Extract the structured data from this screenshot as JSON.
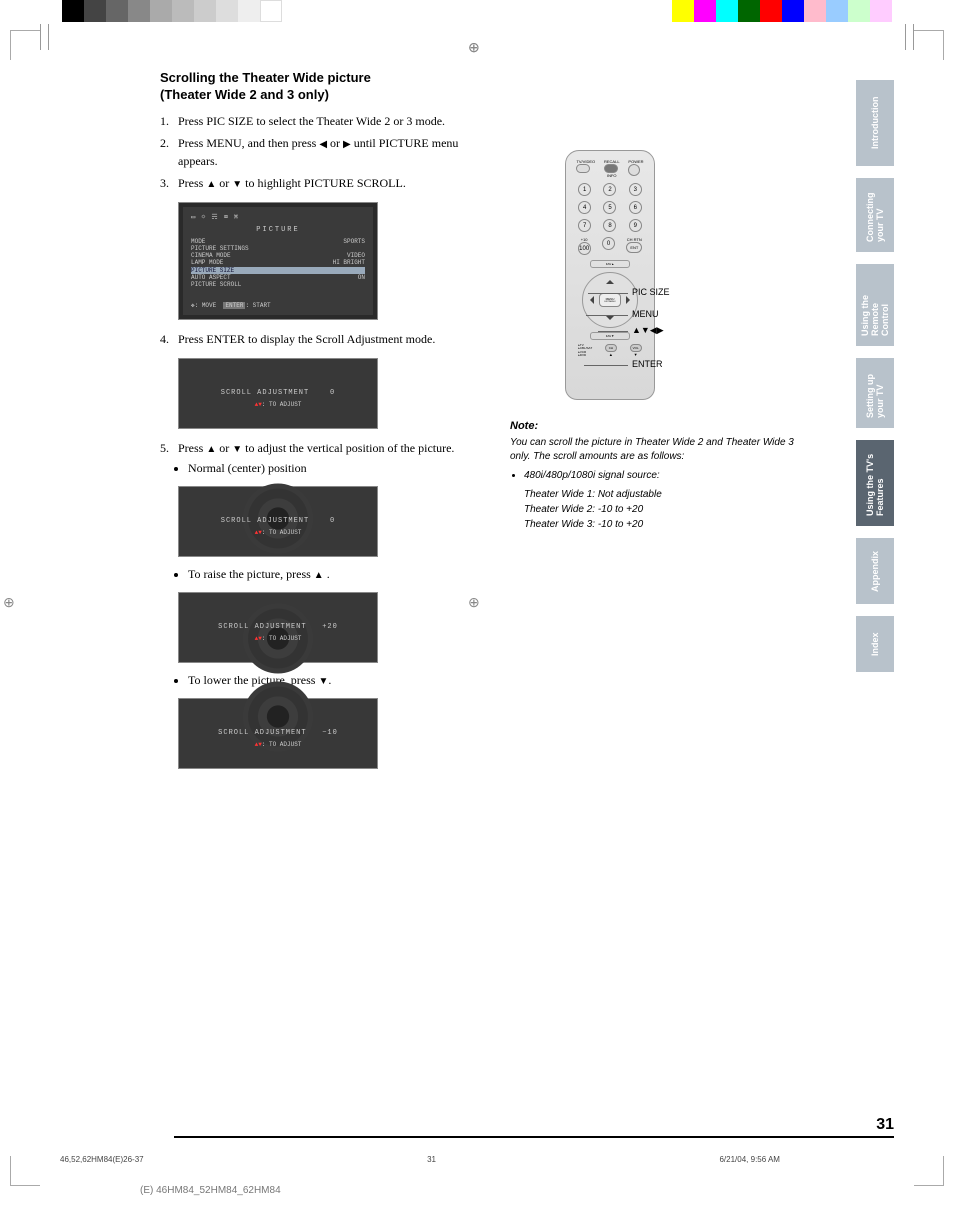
{
  "header": {
    "title_line1": "Scrolling the Theater Wide picture",
    "title_line2": "(Theater Wide 2 and 3 only)"
  },
  "steps": {
    "s1": "Press PIC SIZE to select the Theater Wide 2 or 3 mode.",
    "s2a": "Press MENU, and then press ",
    "s2b": " or ",
    "s2c": " until PICTURE menu appears.",
    "s3a": "Press ",
    "s3b": " or ",
    "s3c": " to highlight PICTURE SCROLL.",
    "s4": "Press ENTER to display the Scroll Adjustment mode.",
    "s5a": "Press ",
    "s5b": " or ",
    "s5c": " to adjust the vertical position of the picture.",
    "bullet_normal": "Normal (center) position",
    "bullet_raise_a": "To raise the picture, press ",
    "bullet_raise_b": " .",
    "bullet_lower_a": "To lower the picture, press ",
    "bullet_lower_b": "."
  },
  "osd_menu": {
    "title": "PICTURE",
    "rows": [
      {
        "l": "MODE",
        "r": "SPORTS"
      },
      {
        "l": "PICTURE SETTINGS",
        "r": ""
      },
      {
        "l": "CINEMA MODE",
        "r": "VIDEO"
      },
      {
        "l": "LAMP MODE",
        "r": "HI BRIGHT"
      },
      {
        "l": "PICTURE SIZE",
        "r": ""
      },
      {
        "l": "AUTO ASPECT",
        "r": "ON"
      },
      {
        "l": "PICTURE SCROLL",
        "r": ""
      }
    ],
    "footer_move": ": MOVE",
    "footer_enter": "ENTER",
    "footer_start": ": START"
  },
  "scroll_box": {
    "label": "SCROLL  ADJUSTMENT",
    "adjust": ": TO  ADJUST",
    "v0": "0",
    "vplus": "+20",
    "vminus": "−10"
  },
  "remote": {
    "top": {
      "tvvideo": "TV/VIDEO",
      "recall": "RECALL",
      "info": "INFO",
      "power": "POWER"
    },
    "nums": [
      "1",
      "2",
      "3",
      "4",
      "5",
      "6",
      "7",
      "8",
      "9",
      "0"
    ],
    "plus10": "+10",
    "chrtn": "CH RTN",
    "ent": "ENT",
    "hundred": "100",
    "fav_up": "FAV▲",
    "fav_dn": "FAV▼",
    "menu": "MENU",
    "exitmenu": "EXIT/MENU",
    "ch": "CH",
    "vol": "VOL",
    "modes": "TV\nCBL/SAT\nVCR\nDVD"
  },
  "callouts": {
    "picsize": "PIC SIZE",
    "menu": "MENU",
    "arrows": "▲▼◀▶",
    "enter": "ENTER"
  },
  "note": {
    "head": "Note:",
    "body": "You can scroll the picture in Theater Wide 2 and Theater Wide 3 only. The scroll amounts are as follows:",
    "src": "480i/480p/1080i signal source:",
    "l1": "Theater Wide 1: Not adjustable",
    "l2": "Theater Wide 2: -10 to +20",
    "l3": "Theater Wide 3: -10 to +20"
  },
  "tabs": [
    "Introduction",
    "Connecting your TV",
    "Using the Remote Control",
    "Setting up your TV",
    "Using the TV's Features",
    "Appendix",
    "Index"
  ],
  "active_tab": 4,
  "page_number": "31",
  "footer": {
    "file": "46,52,62HM84(E)26-37",
    "pg": "31",
    "date": "6/21/04, 9:56 AM"
  },
  "model": "(E) 46HM84_52HM84_62HM84"
}
